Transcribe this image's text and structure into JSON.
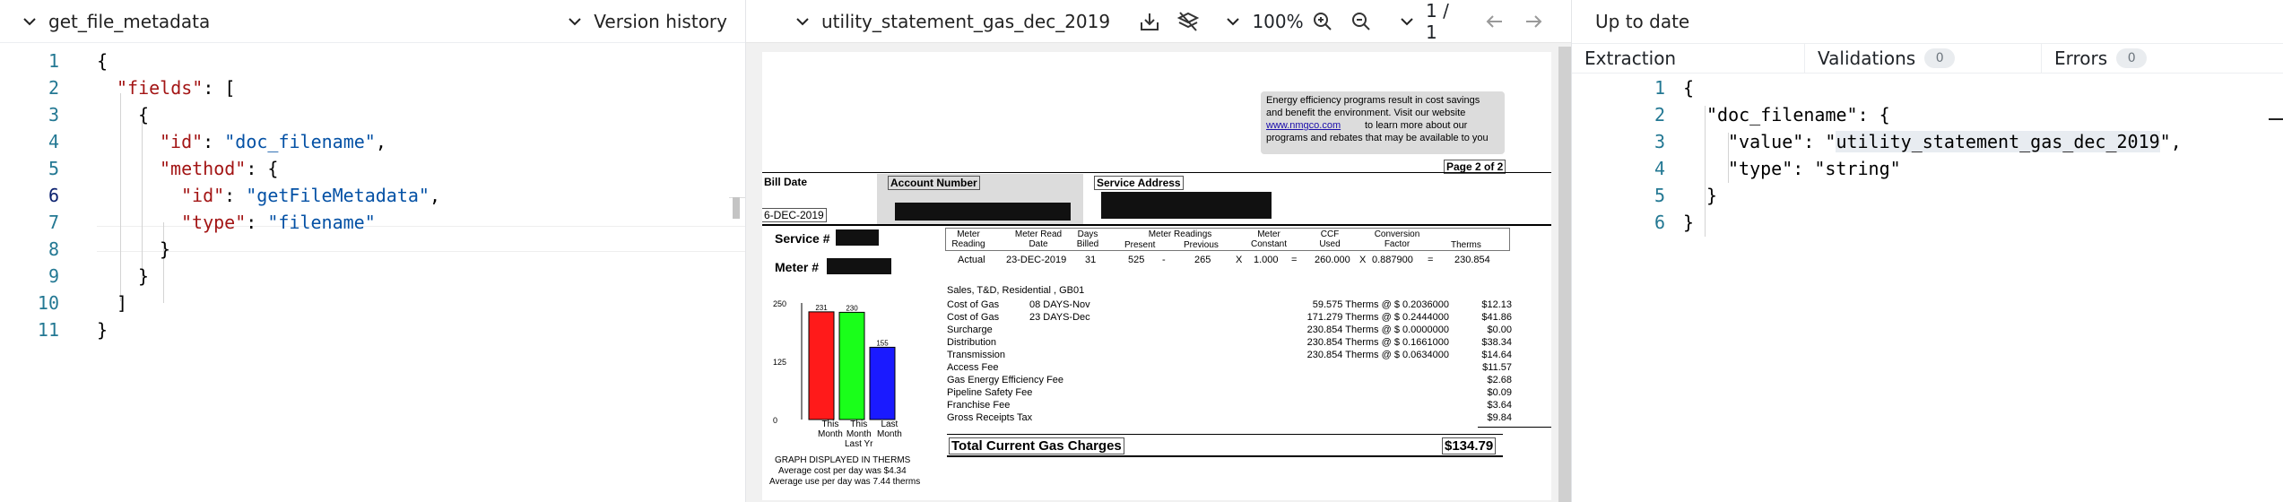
{
  "left_panel": {
    "title": "get_file_metadata",
    "version_history_label": "Version history",
    "line_numbers": [
      "1",
      "2",
      "3",
      "4",
      "5",
      "6",
      "7",
      "8",
      "9",
      "10",
      "11"
    ]
  },
  "json_code": {
    "l1": "{",
    "fields_key": "\"fields\"",
    "colon_bracket": ": [",
    "l3": "{",
    "id_key": "\"id\"",
    "id_val": "\"doc_filename\"",
    "method_key": "\"method\"",
    "method_open": ": {",
    "id_key2": "\"id\"",
    "id_val2": "\"getFileMetadata\"",
    "type_key": "\"type\"",
    "type_val": "\"filename\"",
    "l8": "}",
    "l9": "}",
    "l10": "]",
    "l11": "}"
  },
  "viewer": {
    "filename": "utility_statement_gas_dec_2019",
    "zoom": "100%",
    "page_indicator": "1 / 1"
  },
  "document": {
    "promo_text_1": "Energy efficiency programs result in cost savings",
    "promo_text_2": "and benefit the environment. Visit our website",
    "promo_link": "www.nmgco.com",
    "promo_text_3": "to learn more about our",
    "promo_text_4": "programs and rebates that may be available to you",
    "page_label": "Page 2 of 2",
    "bill_date_label": "Bill Date",
    "bill_date_value": "6-DEC-2019",
    "account_number_label": "Account Number",
    "service_address_label": "Service Address",
    "service_label": "Service #",
    "meter_label": "Meter #",
    "meter_headers": [
      "Meter Reading",
      "Meter Read Date",
      "Days Billed",
      "Meter Readings",
      "Meter Constant",
      "CCF Used",
      "Conversion Factor",
      "Therms"
    ],
    "meter_subheaders": [
      "Present",
      "Previous"
    ],
    "meter_row": [
      "Actual",
      "23-DEC-2019",
      "31",
      "525",
      "-",
      "265",
      "X",
      "1.000",
      "=",
      "260.000",
      "X",
      "0.887900",
      "=",
      "230.854"
    ],
    "section_title": "Sales, T&D, Residential , GB01",
    "charges": [
      {
        "label": "Cost of Gas",
        "extra": "08 DAYS-Nov",
        "calc": "59.575 Therms @  $ 0.2036000",
        "amount": "$12.13"
      },
      {
        "label": "Cost of Gas",
        "extra": "23 DAYS-Dec",
        "calc": "171.279 Therms @  $ 0.2444000",
        "amount": "$41.86"
      },
      {
        "label": "Surcharge",
        "extra": "",
        "calc": "230.854 Therms @  $ 0.0000000",
        "amount": "$0.00"
      },
      {
        "label": "Distribution",
        "extra": "",
        "calc": "230.854 Therms @  $ 0.1661000",
        "amount": "$38.34"
      },
      {
        "label": "Transmission",
        "extra": "",
        "calc": "230.854 Therms @  $ 0.0634000",
        "amount": "$14.64"
      },
      {
        "label": "Access Fee",
        "extra": "",
        "calc": "",
        "amount": "$11.57"
      },
      {
        "label": "Gas Energy Efficiency Fee",
        "extra": "",
        "calc": "",
        "amount": "$2.68"
      },
      {
        "label": "Pipeline Safety Fee",
        "extra": "",
        "calc": "",
        "amount": "$0.09"
      },
      {
        "label": "Franchise Fee",
        "extra": "",
        "calc": "",
        "amount": "$3.64"
      },
      {
        "label": "Gross Receipts Tax",
        "extra": "",
        "calc": "",
        "amount": "$9.84"
      }
    ],
    "total_label": "Total Current Gas Charges",
    "total_amount": "$134.79",
    "graph_caption": "GRAPH DISPLAYED IN THERMS",
    "avg_cost": "Average cost per day was $4.34",
    "avg_use": "Average use per day was 7.44 therms",
    "chart_labels": {
      "this_month": [
        "This",
        "Month"
      ],
      "this_month_last_yr": [
        "This",
        "Month",
        "Last Yr"
      ],
      "last_month": [
        "Last",
        "Month"
      ]
    }
  },
  "chart_data": {
    "type": "bar",
    "categories": [
      "This Month",
      "This Month Last Yr",
      "Last Month"
    ],
    "values": [
      231,
      230,
      155
    ],
    "colors": [
      "#ff1a1a",
      "#1aff1a",
      "#1a1aff"
    ],
    "value_labels": [
      "231",
      "230",
      "155"
    ],
    "ytick_labels": [
      "250",
      "125",
      "0"
    ],
    "ylim": [
      0,
      250
    ]
  },
  "right_panel": {
    "status": "Up to date",
    "tabs": [
      {
        "label": "Extraction",
        "count": ""
      },
      {
        "label": "Validations",
        "count": "0"
      },
      {
        "label": "Errors",
        "count": "0"
      }
    ],
    "line_numbers": [
      "1",
      "2",
      "3",
      "4",
      "5",
      "6"
    ],
    "code": {
      "l1": "{",
      "key": "\"doc_filename\"",
      "open": ": {",
      "value_key": "\"value\"",
      "value_q": "\"",
      "value_val": "utility_statement_gas_dec_2019",
      "value_end": "\",",
      "type_key": "\"type\"",
      "type_val": "\"string\"",
      "l5": "}",
      "l6": "}"
    }
  }
}
